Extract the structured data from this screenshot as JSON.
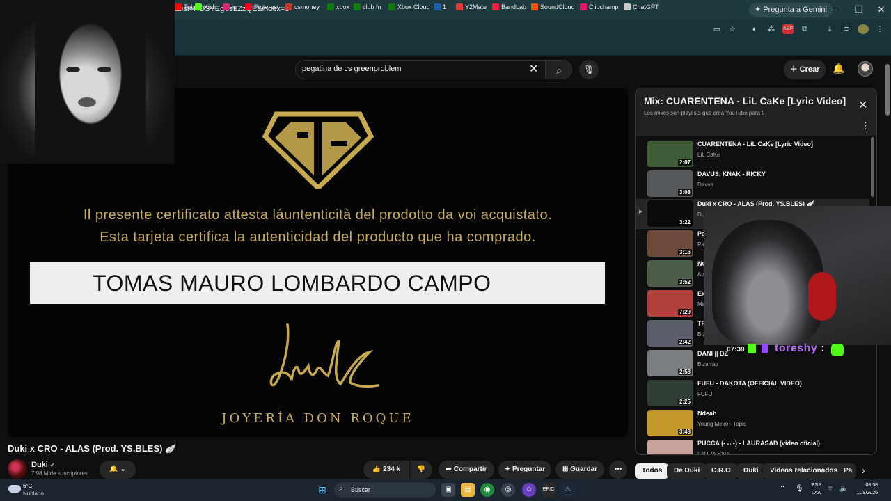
{
  "browser": {
    "gemini_label": "Pregunta a Gemini",
    "url_fragment": "&list=RDSYEgVsLZzQE&index=3",
    "bookmarks": [
      {
        "label": "Tube",
        "color": "#ff0000"
      },
      {
        "label": "Kick",
        "color": "#53fc18"
      },
      {
        "label": "ig",
        "color": "#d62976"
      },
      {
        "label": "Pinterest",
        "color": "#e60023"
      },
      {
        "label": "csmoney",
        "color": "#c0392b"
      },
      {
        "label": "xbox",
        "color": "#107c10"
      },
      {
        "label": "club fn",
        "color": "#107c10"
      },
      {
        "label": "Xbox Cloud",
        "color": "#107c10"
      },
      {
        "label": "1",
        "color": "#1b5fa8"
      },
      {
        "label": "Y2Mate",
        "color": "#e53935"
      },
      {
        "label": "BandLab",
        "color": "#f0243f"
      },
      {
        "label": "SoundCloud",
        "color": "#ff5500"
      },
      {
        "label": "Clipchamp",
        "color": "#e01b63"
      },
      {
        "label": "ChatGPT",
        "color": "#cccccc"
      }
    ]
  },
  "youtube": {
    "search_value": "pegatina de cs greenproblem",
    "create_label": "Crear"
  },
  "video": {
    "cert_line1": "Il presente certificato attesta láuntenticità del prodotto da voi acquistato.",
    "cert_line2": "Esta tarjeta certifica la autenticidad del producto que ha comprado.",
    "name": "TOMAS MAURO LOMBARDO CAMPO",
    "brand": "JOYERÍA DON ROQUE",
    "title": "Duki x CRO - ALAS (Prod. YS.BLES) 🪽",
    "channel": "Duki",
    "subscribers": "7.98 M de suscriptores",
    "likes": "234 k",
    "share_label": "Compartir",
    "ask_label": "Preguntar",
    "save_label": "Guardar"
  },
  "playlist": {
    "title": "Mix: CUARENTENA - LiL CaKe [Lyric Video]",
    "subtitle": "Los mixes son playlists que crea YouTube para ti",
    "items": [
      {
        "title": "CUARENTENA - LiL CaKe [Lyric Video]",
        "channel": "LiL CaKe",
        "duration": "2:07",
        "thumb": "#3f5a36"
      },
      {
        "title": "DAVUS, KNAK - RICKY",
        "channel": "Davus",
        "duration": "3:08",
        "thumb": "#56595c"
      },
      {
        "title": "Duki x CRO - ALAS (Prod. YS.BLES) 🪽",
        "channel": "Du",
        "duration": "3:22",
        "thumb": "#0b0b0b"
      },
      {
        "title": "Pa",
        "channel": "Pa",
        "duration": "3:16",
        "thumb": "#6b4a3b"
      },
      {
        "title": "NC",
        "channel": "Au",
        "duration": "3:52",
        "thumb": "#4d5c49"
      },
      {
        "title": "Ex",
        "channel": "Me",
        "duration": "7:29",
        "thumb": "#b0403a"
      },
      {
        "title": "TR",
        "channel": "Biz",
        "duration": "2:42",
        "thumb": "#5a5f6b"
      },
      {
        "title": "DANI || BZ",
        "channel": "Bizarrap",
        "duration": "2:58",
        "thumb": "#7a7d82"
      },
      {
        "title": "FUFU - DAKOTA (OFFICIAL VIDEO)",
        "channel": "FUFU",
        "duration": "2:25",
        "thumb": "#2f3d33"
      },
      {
        "title": "Ndeah",
        "channel": "Young Mirko - Topic",
        "duration": "3:48",
        "thumb": "#c4992b"
      },
      {
        "title": "PUCCA (•̀ ᴗ •́) - LAURASAD (video oficial)",
        "channel": "LAURA SAD",
        "duration": "",
        "thumb": "#c9a49c"
      }
    ]
  },
  "overlay": {
    "time": "07:39",
    "user": "toreshy",
    "sep": ":"
  },
  "chips": [
    "Todos",
    "De Duki",
    "C.R.O",
    "Duki",
    "Videos relacionados",
    "Pa"
  ],
  "taskbar": {
    "temp": "6°C",
    "weather": "Nublado",
    "search": "Buscar",
    "lang1": "ESP",
    "lang2": "LAA",
    "time": "08:58",
    "date": "11/8/2026"
  }
}
